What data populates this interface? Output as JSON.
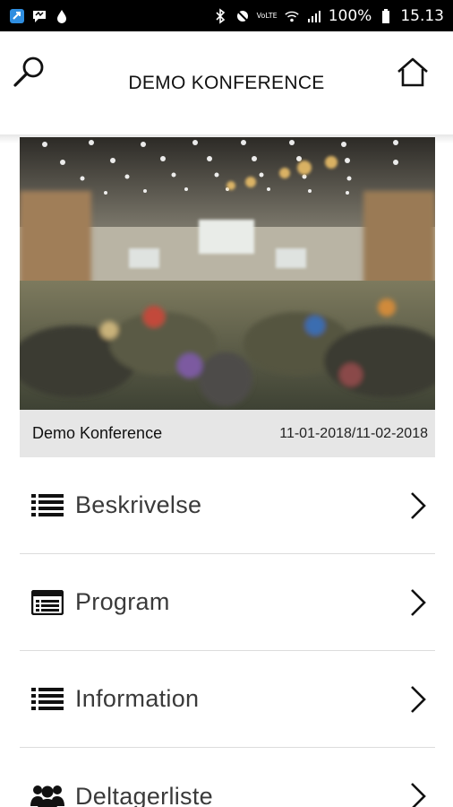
{
  "status_bar": {
    "battery": "100%",
    "time": "15.13",
    "volte": "VoLTE"
  },
  "header": {
    "title": "DEMO KONFERENCE",
    "left_icon": "search-icon",
    "right_icon": "home-icon"
  },
  "event": {
    "name": "Demo Konference",
    "dates": "11-01-2018/11-02-2018"
  },
  "menu": {
    "items": [
      {
        "label": "Beskrivelse",
        "icon": "list-icon"
      },
      {
        "label": "Program",
        "icon": "program-icon"
      },
      {
        "label": "Information",
        "icon": "list-icon"
      },
      {
        "label": "Deltagerliste",
        "icon": "people-icon"
      }
    ]
  }
}
